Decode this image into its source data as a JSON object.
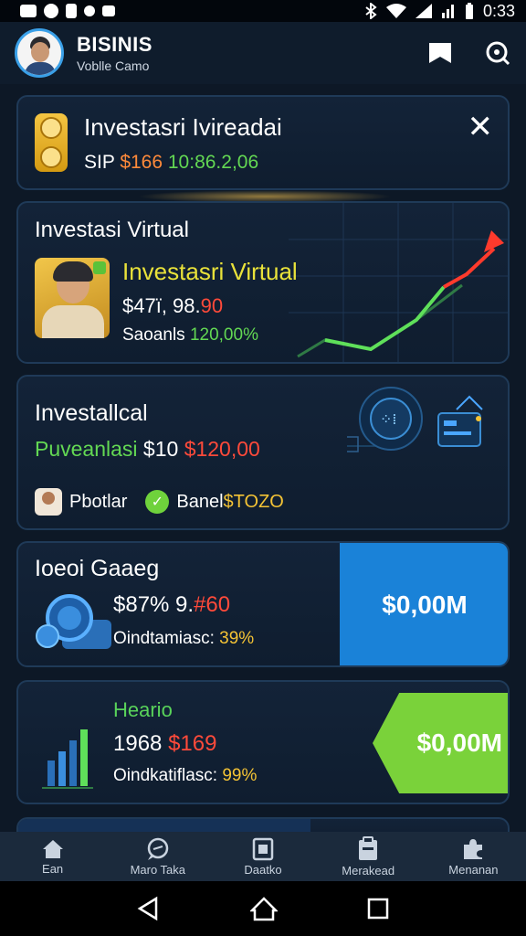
{
  "status_bar": {
    "time": "0:33",
    "icons": [
      "notification-icon",
      "location-icon",
      "alarm-icon",
      "bluetooth-icon",
      "wifi-icon",
      "signal-icon",
      "battery-icon"
    ]
  },
  "header": {
    "title": "BISINIS",
    "subtitle": "Voblle Camo",
    "actions": [
      "bookmark-icon",
      "search-icon"
    ]
  },
  "card1": {
    "title": "Investasri Ivireadai",
    "line_prefix": "SIP",
    "line_red": "$166",
    "line_green": "10:86.2,06"
  },
  "card2": {
    "heading": "Investasi Virtual",
    "subtitle": "Investasri Virtual",
    "value_white": "$47ï, 98.",
    "value_red": "90",
    "stat_label": "Saoanls",
    "stat_value": "120,00%"
  },
  "card3": {
    "heading": "Investallcal",
    "line_green": "Puveanlasi",
    "line_white": "$10",
    "line_red": "$120,00",
    "footer_label": "Pbotlar",
    "footer_badge_prefix": "Banel",
    "footer_badge_value": "$TOZO"
  },
  "card4": {
    "heading": "Ioeoi Gaaeg",
    "value_white": "$87% 9.",
    "value_red": "#60",
    "stat_label": "Oindtamiasc:",
    "stat_value": "39%",
    "button_label": "$0,00M"
  },
  "card5": {
    "heading": "Heario",
    "value_white": "1968",
    "value_red": "$169",
    "stat_label": "Oindkatiflasc:",
    "stat_value": "99%",
    "button_label": "$0,00M"
  },
  "bottom_nav": [
    {
      "label": "Ean",
      "icon": "home-icon"
    },
    {
      "label": "Maro Taka",
      "icon": "chat-icon"
    },
    {
      "label": "Daatko",
      "icon": "document-icon"
    },
    {
      "label": "Merakead",
      "icon": "clipboard-icon"
    },
    {
      "label": "Menanan",
      "icon": "puzzle-icon"
    }
  ],
  "colors": {
    "background": "#0d1826",
    "card_border": "#1f3a58",
    "accent_blue": "#1a82d8",
    "accent_green": "#7ad23a",
    "accent_red": "#ff4a3a",
    "accent_yellow": "#e9e23a"
  }
}
